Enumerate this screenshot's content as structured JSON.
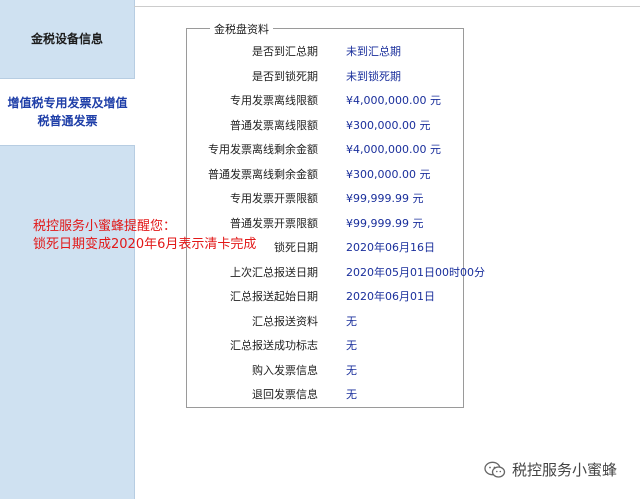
{
  "sidebar": {
    "items": [
      {
        "label": "金税设备信息"
      },
      {
        "label": "增值税专用发票及增值税普通发票"
      }
    ]
  },
  "panel": {
    "title": "金税盘资料",
    "rows": [
      {
        "label": "是否到汇总期",
        "value": "未到汇总期"
      },
      {
        "label": "是否到锁死期",
        "value": "未到锁死期"
      },
      {
        "label": "专用发票离线限额",
        "value": "¥4,000,000.00 元"
      },
      {
        "label": "普通发票离线限额",
        "value": "¥300,000.00 元"
      },
      {
        "label": "专用发票离线剩余金额",
        "value": "¥4,000,000.00 元"
      },
      {
        "label": "普通发票离线剩余金额",
        "value": "¥300,000.00 元"
      },
      {
        "label": "专用发票开票限额",
        "value": "¥99,999.99 元"
      },
      {
        "label": "普通发票开票限额",
        "value": "¥99,999.99 元"
      },
      {
        "label": "锁死日期",
        "value": "2020年06月16日"
      },
      {
        "label": "上次汇总报送日期",
        "value": "2020年05月01日00时00分"
      },
      {
        "label": "汇总报送起始日期",
        "value": "2020年06月01日"
      },
      {
        "label": "汇总报送资料",
        "value": "无"
      },
      {
        "label": "汇总报送成功标志",
        "value": "无"
      },
      {
        "label": "购入发票信息",
        "value": "无"
      },
      {
        "label": "退回发票信息",
        "value": "无"
      }
    ]
  },
  "annotation": {
    "line1": "税控服务小蜜蜂提醒您：",
    "line2": "锁死日期变成2020年6月表示清卡完成"
  },
  "watermark": {
    "text": "税控服务小蜜蜂",
    "icon": "wechat-icon"
  },
  "colors": {
    "sidebar_bg": "#cfe1f1",
    "active_text": "#1f3fa8",
    "value_text": "#1a2f9c",
    "annotation_text": "#e21818"
  }
}
